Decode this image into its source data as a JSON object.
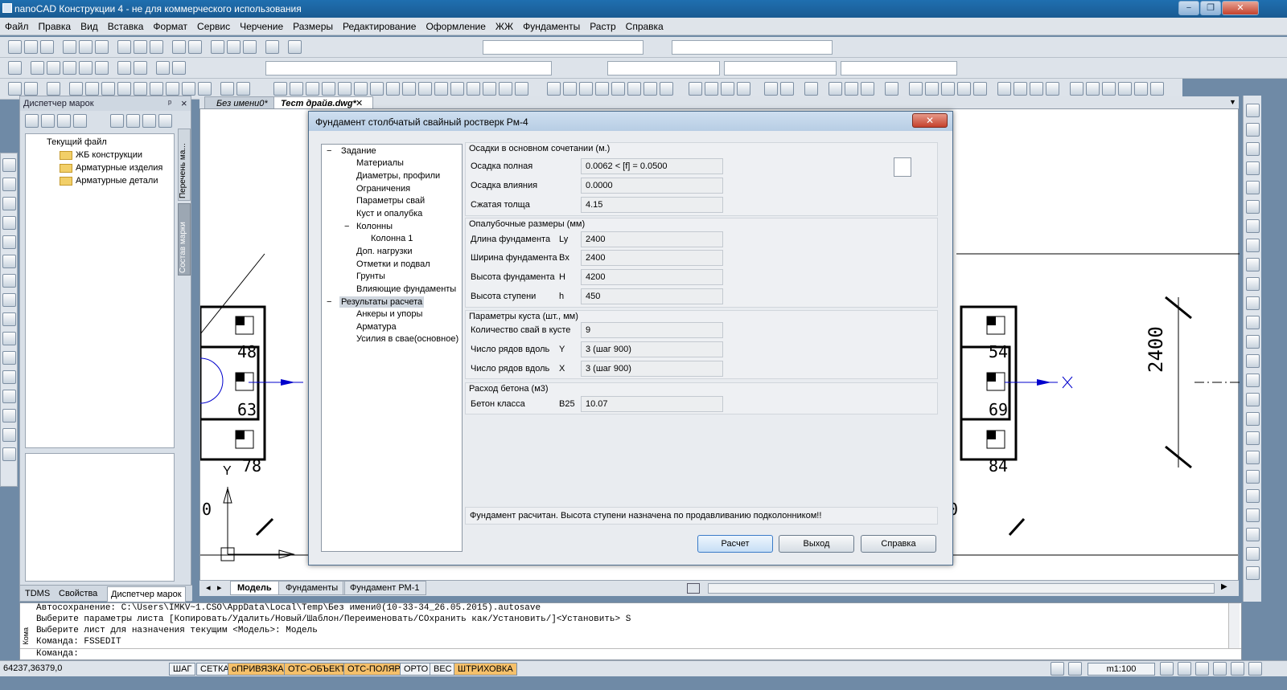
{
  "window": {
    "title": "nanoCAD Конструкции 4 - не для коммерческого использования",
    "min": "−",
    "max": "❐",
    "close": "✕"
  },
  "menu": [
    "Файл",
    "Правка",
    "Вид",
    "Вставка",
    "Формат",
    "Сервис",
    "Черчение",
    "Размеры",
    "Редактирование",
    "Оформление",
    "ЖЖ",
    "Фундаменты",
    "Растр",
    "Справка"
  ],
  "left_panel": {
    "title": "Диспетчер марок",
    "pin": "ᵖ",
    "close": "×",
    "vtab1": "Перечень ма...",
    "vtab2": "Состав марки",
    "tree": {
      "root": "Текущий файл",
      "items": [
        "ЖБ конструкции",
        "Арматурные изделия",
        "Арматурные детали"
      ]
    },
    "bottom_tabs": [
      "TDMS",
      "Свойства",
      "Диспетчер марок"
    ]
  },
  "doc_tabs": [
    "Без имени0*",
    "Тест драйв.dwg*"
  ],
  "layout_tabs": [
    "Модель",
    "Фундаменты",
    "Фундамент РМ-1"
  ],
  "drawing": {
    "dim_right": "2400",
    "labels_left": [
      "48",
      "63",
      "78",
      "0"
    ],
    "labels_right": [
      "54",
      "69",
      "84",
      "0"
    ],
    "y_axis": "Y",
    "x_marker": "X"
  },
  "dialog": {
    "title": "Фундамент столбчатый свайный ростверк Рм-4",
    "close": "✕",
    "tree": [
      {
        "label": "Задание",
        "level": 0,
        "expander": "−"
      },
      {
        "label": "Материалы",
        "level": 1
      },
      {
        "label": "Диаметры, профили",
        "level": 1
      },
      {
        "label": "Ограничения",
        "level": 1
      },
      {
        "label": "Параметры свай",
        "level": 1
      },
      {
        "label": "Куст и опалубка",
        "level": 1
      },
      {
        "label": "Колонны",
        "level": 1,
        "expander": "−"
      },
      {
        "label": "Колонна 1",
        "level": 2
      },
      {
        "label": "Доп. нагрузки",
        "level": 1
      },
      {
        "label": "Отметки и подвал",
        "level": 1
      },
      {
        "label": "Грунты",
        "level": 1
      },
      {
        "label": "Влияющие фундаменты",
        "level": 1
      },
      {
        "label": "Результаты расчета",
        "level": 0,
        "expander": "−",
        "selected": true
      },
      {
        "label": "Анкеры и упоры",
        "level": 1
      },
      {
        "label": "Арматура",
        "level": 1
      },
      {
        "label": "Усилия в сваe(основное)",
        "level": 1
      }
    ],
    "groups": [
      {
        "title": "Осадки в основном сочетании (м.)",
        "rows": [
          {
            "label": "Осадка полная",
            "sub": "",
            "value": "0.0062 < [f] = 0.0500"
          },
          {
            "label": "Осадка влияния",
            "sub": "",
            "value": "0.0000"
          },
          {
            "label": "Сжатая толща",
            "sub": "",
            "value": "4.15"
          }
        ]
      },
      {
        "title": "Опалубочные размеры (мм)",
        "rows": [
          {
            "label": "Длина фундамента",
            "sub": "Ly",
            "value": "2400"
          },
          {
            "label": "Ширина фундамента",
            "sub": "Bx",
            "value": "2400"
          },
          {
            "label": "Высота фундамента",
            "sub": "H",
            "value": "4200"
          },
          {
            "label": "Высота ступени",
            "sub": "h",
            "value": "450"
          }
        ]
      },
      {
        "title": "Параметры куста (шт., мм)",
        "rows": [
          {
            "label": "Количество свай в кусте",
            "sub": "",
            "value": "9"
          },
          {
            "label": "Число рядов вдоль",
            "sub": "Y",
            "value": "3 (шаг 900)"
          },
          {
            "label": "Число рядов вдоль",
            "sub": "X",
            "value": "3 (шаг 900)"
          }
        ]
      },
      {
        "title": "Расход бетона (м3)",
        "rows": [
          {
            "label": "Бетон класса",
            "sub": "B25",
            "value": "10.07"
          }
        ]
      }
    ],
    "message": "Фундамент расчитан. Высота ступени назначена по продавливанию подколонником!!",
    "buttons": {
      "calc": "Расчет",
      "exit": "Выход",
      "help": "Справка"
    }
  },
  "command": {
    "lines": [
      "Автосохранение: C:\\Users\\IMKV~1.CSO\\AppData\\Local\\Temp\\Без имени0(10-33-34_26.05.2015).autosave",
      "Выберите параметры листа [Копировать/Удалить/Новый/Шаблон/Переименовать/СОхранить как/Установить/]<Установить> S",
      "Выберите лист для назначения текущим <Модель>: Модель",
      "Команда: FSSEDIT"
    ],
    "prompt": "Команда:",
    "side_label": "Кома"
  },
  "status": {
    "coords": "64237,36379,0",
    "toggles": [
      {
        "label": "ШАГ",
        "on": false
      },
      {
        "label": "СЕТКА",
        "on": false
      },
      {
        "label": "оПРИВЯЗКА",
        "on": true
      },
      {
        "label": "ОТС-ОБЪЕКТ",
        "on": true
      },
      {
        "label": "ОТС-ПОЛЯР",
        "on": true
      },
      {
        "label": "ОРТО",
        "on": false
      },
      {
        "label": "ВЕС",
        "on": false
      },
      {
        "label": "ШТРИХОВКА",
        "on": true
      }
    ],
    "scale": "m1:100"
  }
}
